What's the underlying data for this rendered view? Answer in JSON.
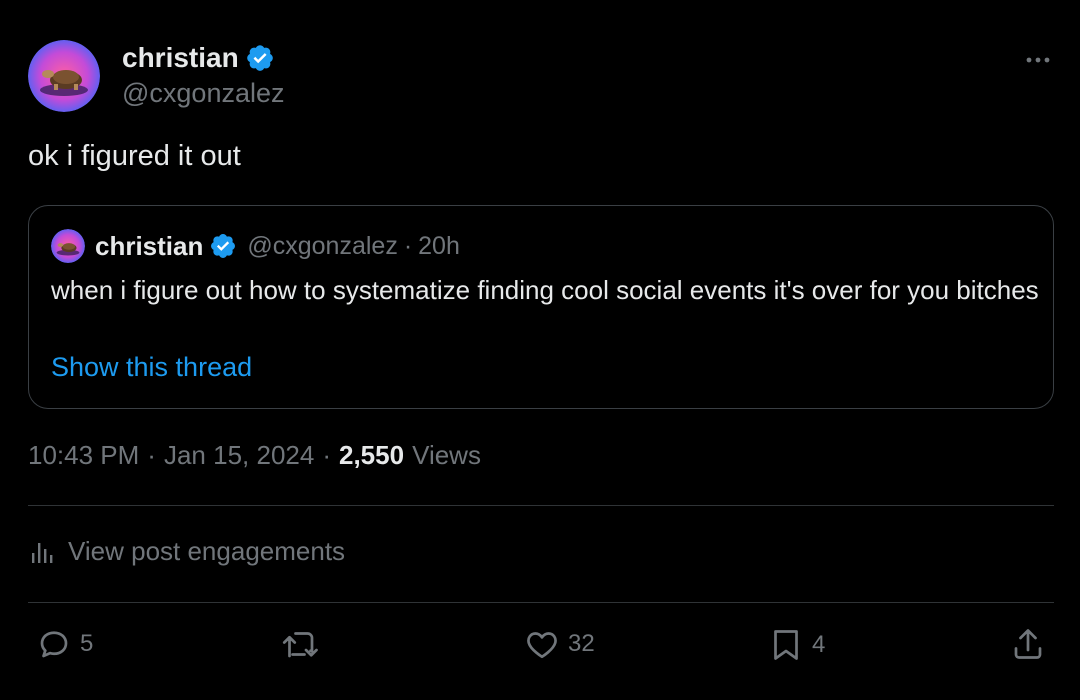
{
  "author": {
    "name": "christian",
    "handle": "@cxgonzalez"
  },
  "tweet": {
    "text": "ok i figured it out"
  },
  "quote": {
    "name": "christian",
    "handle": "@cxgonzalez",
    "separator": "·",
    "time": "20h",
    "text": "when i figure out how to systematize finding cool social events it's over for you bitches",
    "show_thread": "Show this thread"
  },
  "meta": {
    "time": "10:43 PM",
    "date": "Jan 15, 2024",
    "separator": "·",
    "views_count": "2,550",
    "views_label": "Views"
  },
  "engagements": {
    "label": "View post engagements"
  },
  "actions": {
    "reply_count": "5",
    "like_count": "32",
    "bookmark_count": "4"
  },
  "icons": {
    "more": "more-icon",
    "verified": "verified-badge-icon",
    "analytics": "analytics-icon",
    "reply": "reply-icon",
    "retweet": "retweet-icon",
    "like": "heart-icon",
    "bookmark": "bookmark-icon",
    "share": "share-icon"
  },
  "colors": {
    "background": "#000000",
    "text": "#e7e9ea",
    "secondary": "#71767b",
    "link": "#1d9bf0",
    "verified": "#1d9bf0",
    "border": "#2f3336"
  }
}
